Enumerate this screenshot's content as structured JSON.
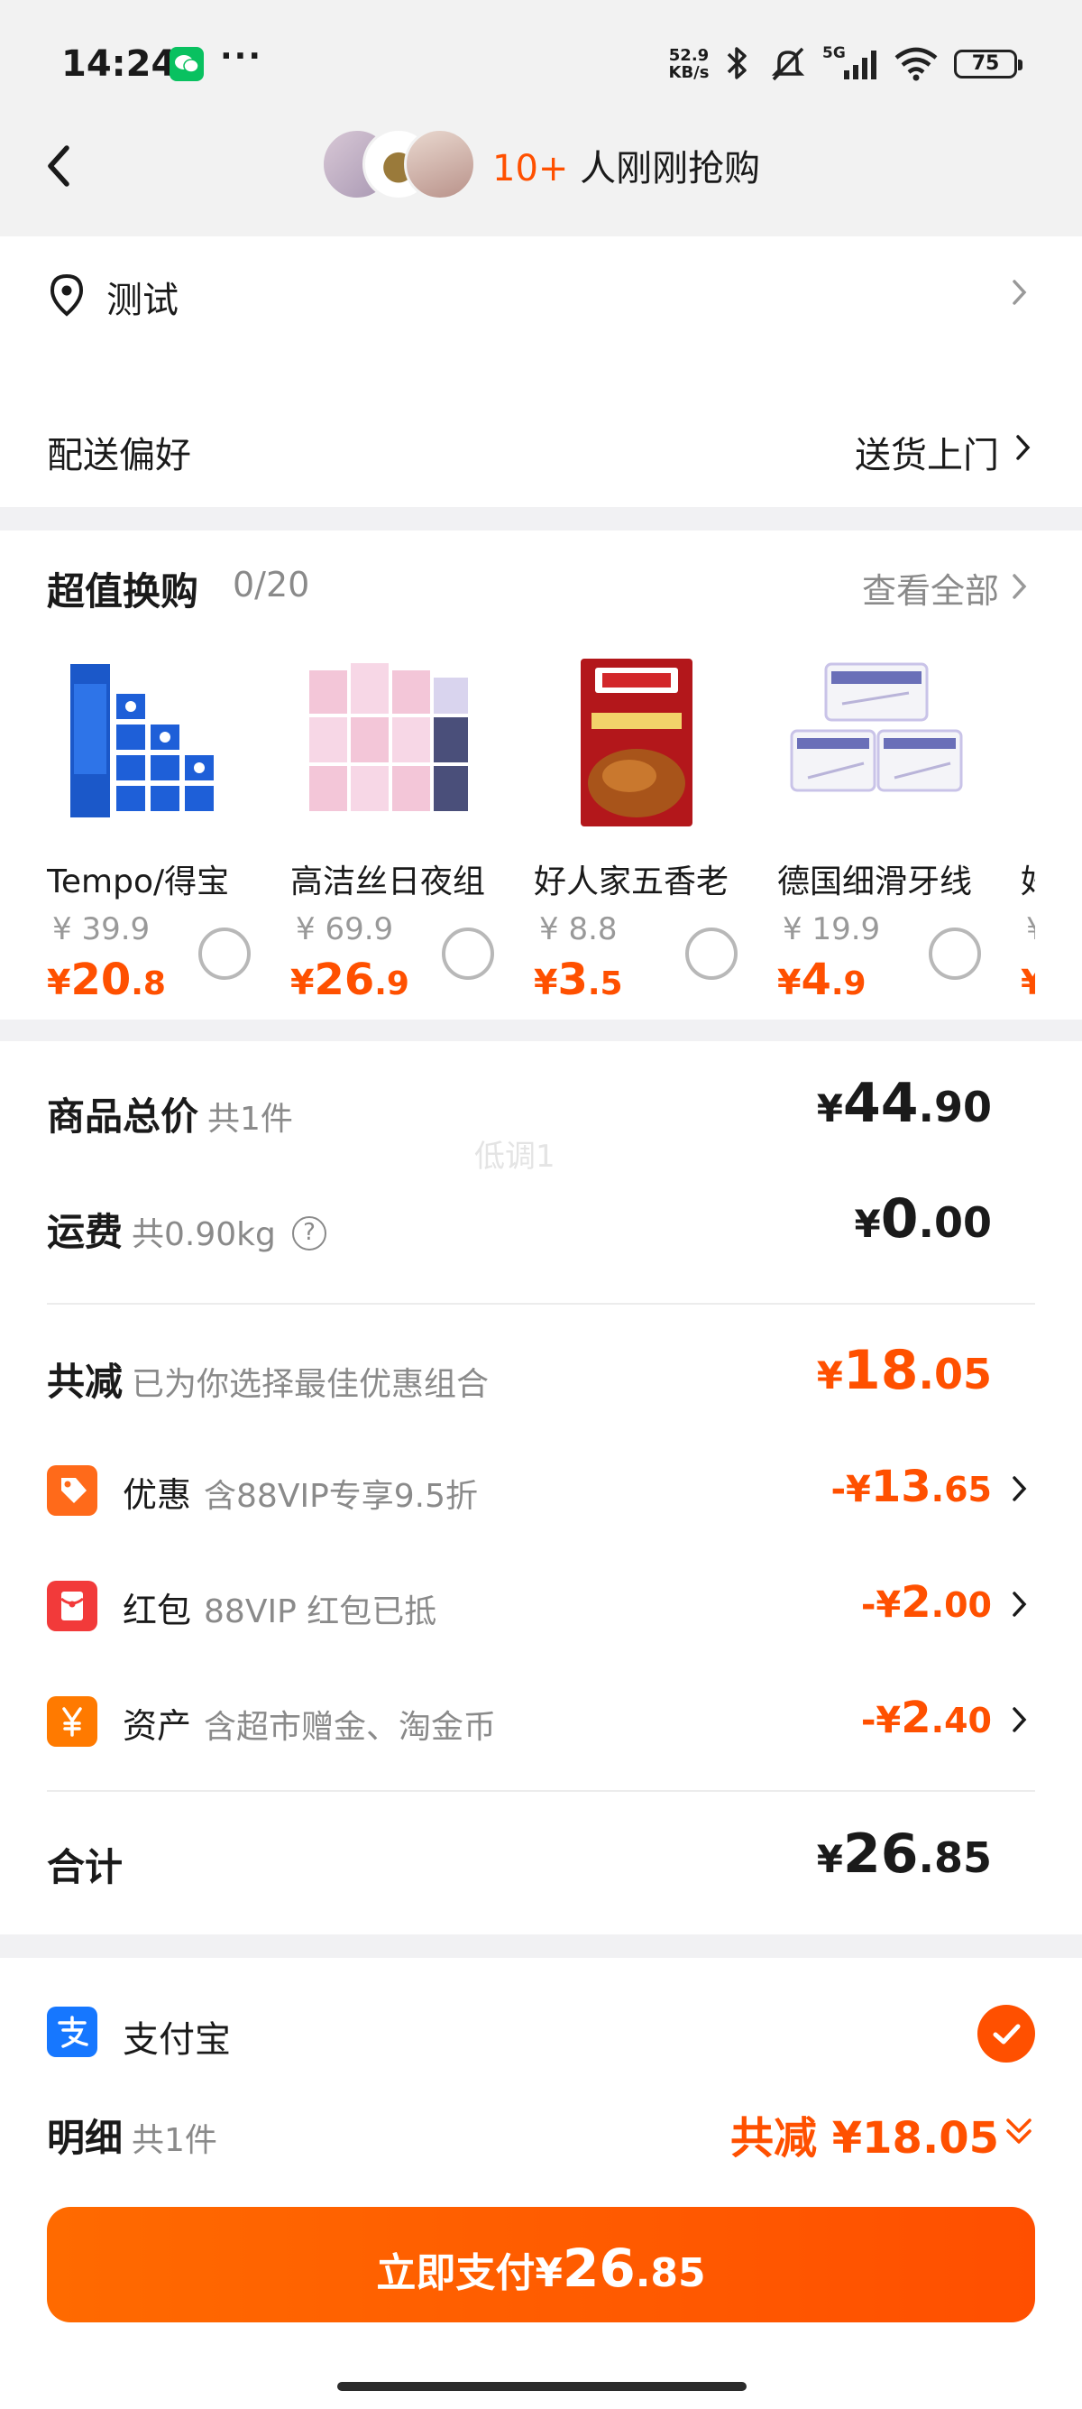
{
  "status_bar": {
    "time": "14:24",
    "more": "···",
    "net_speed_value": "52.9",
    "net_speed_unit": "KB/s",
    "network": "5G",
    "battery": "75"
  },
  "header": {
    "highlight": "10+",
    "title": " 人刚刚抢购"
  },
  "address": {
    "name": "测试"
  },
  "delivery": {
    "label": "配送偏好",
    "value": "送货上门"
  },
  "swap": {
    "title": "超值换购",
    "count": "0/20",
    "view_all": "查看全部",
    "products": [
      {
        "name": "Tempo/得宝",
        "orig_price": "¥ 39.9",
        "price_symbol": "¥",
        "price_int": "20",
        "price_dec": ".8"
      },
      {
        "name": "高洁丝日夜组",
        "orig_price": "¥ 69.9",
        "price_symbol": "¥",
        "price_int": "26",
        "price_dec": ".9"
      },
      {
        "name": "好人家五香老",
        "orig_price": "¥ 8.8",
        "price_symbol": "¥",
        "price_int": "3",
        "price_dec": ".5"
      },
      {
        "name": "德国细滑牙线",
        "orig_price": "¥ 19.9",
        "price_symbol": "¥",
        "price_int": "4",
        "price_dec": ".9"
      },
      {
        "name": "好",
        "orig_price": "¥",
        "price_symbol": "¥",
        "price_int": "",
        "price_dec": ""
      }
    ]
  },
  "summary": {
    "watermark": "低调1",
    "goods_total": {
      "label": "商品总价",
      "sub": "共1件",
      "symbol": "¥",
      "int": "44",
      "dec": ".90"
    },
    "shipping": {
      "label": "运费",
      "sub": "共0.90kg",
      "help": "?",
      "symbol": "¥",
      "int": "0",
      "dec": ".00"
    },
    "total_discount": {
      "label": "共减",
      "sub": "已为你选择最佳优惠组合",
      "symbol": "¥",
      "int": "18",
      "dec": ".05"
    },
    "discounts": [
      {
        "label": "优惠",
        "note": "含88VIP专享9.5折",
        "symbol": "-¥",
        "int": "13",
        "dec": ".65"
      },
      {
        "label": "红包",
        "note": "88VIP 红包已抵",
        "symbol": "-¥",
        "int": "2",
        "dec": ".00"
      },
      {
        "label": "资产",
        "note": "含超市赠金、淘金币",
        "symbol": "-¥",
        "int": "2",
        "dec": ".40"
      }
    ],
    "total": {
      "label": "合计",
      "symbol": "¥",
      "int": "26",
      "dec": ".85"
    }
  },
  "payment": {
    "method": "支付宝",
    "detail_label": "明细",
    "detail_sub": "共1件",
    "detail_saving": "共减 ¥18.05",
    "button_label": "立即支付",
    "button_symbol": "¥",
    "button_int": "26",
    "button_dec": ".85"
  },
  "colors": {
    "accent": "#ff5000",
    "background": "#f1f1f3",
    "alipay": "#1677ff"
  }
}
